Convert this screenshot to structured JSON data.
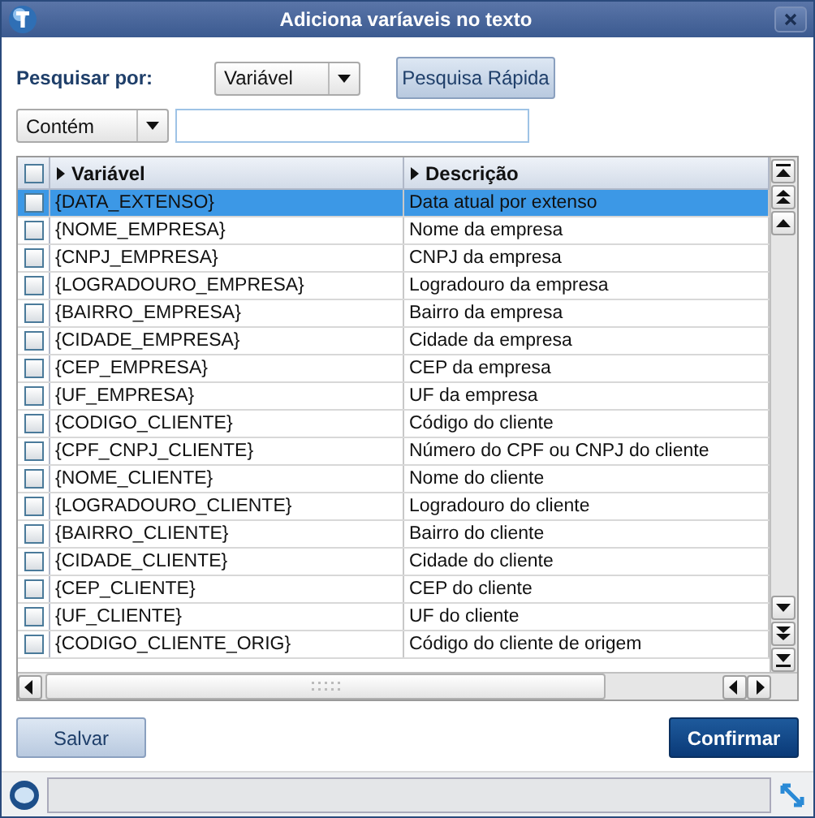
{
  "window": {
    "title": "Adiciona varíaveis no texto"
  },
  "search": {
    "label": "Pesquisar por:",
    "field_select": "Variável",
    "quick_button": "Pesquisa Rápida",
    "operator_select": "Contém"
  },
  "table": {
    "all_checked": false,
    "columns": [
      "Variável",
      "Descrição"
    ],
    "rows": [
      {
        "variable": "{DATA_EXTENSO}",
        "description": "Data atual por extenso",
        "checked": false,
        "selected": true
      },
      {
        "variable": "{NOME_EMPRESA}",
        "description": "Nome da empresa",
        "checked": false,
        "selected": false
      },
      {
        "variable": "{CNPJ_EMPRESA}",
        "description": "CNPJ da empresa",
        "checked": false,
        "selected": false
      },
      {
        "variable": "{LOGRADOURO_EMPRESA}",
        "description": "Logradouro da empresa",
        "checked": false,
        "selected": false
      },
      {
        "variable": "{BAIRRO_EMPRESA}",
        "description": "Bairro da empresa",
        "checked": false,
        "selected": false
      },
      {
        "variable": "{CIDADE_EMPRESA}",
        "description": "Cidade da empresa",
        "checked": false,
        "selected": false
      },
      {
        "variable": "{CEP_EMPRESA}",
        "description": "CEP da empresa",
        "checked": false,
        "selected": false
      },
      {
        "variable": "{UF_EMPRESA}",
        "description": "UF da empresa",
        "checked": false,
        "selected": false
      },
      {
        "variable": "{CODIGO_CLIENTE}",
        "description": "Código do cliente",
        "checked": false,
        "selected": false
      },
      {
        "variable": "{CPF_CNPJ_CLIENTE}",
        "description": "Número do CPF ou CNPJ do cliente",
        "checked": false,
        "selected": false
      },
      {
        "variable": "{NOME_CLIENTE}",
        "description": "Nome do cliente",
        "checked": false,
        "selected": false
      },
      {
        "variable": "{LOGRADOURO_CLIENTE}",
        "description": "Logradouro do cliente",
        "checked": false,
        "selected": false
      },
      {
        "variable": "{BAIRRO_CLIENTE}",
        "description": "Bairro do cliente",
        "checked": false,
        "selected": false
      },
      {
        "variable": "{CIDADE_CLIENTE}",
        "description": "Cidade do cliente",
        "checked": false,
        "selected": false
      },
      {
        "variable": "{CEP_CLIENTE}",
        "description": "CEP do cliente",
        "checked": false,
        "selected": false
      },
      {
        "variable": "{UF_CLIENTE}",
        "description": "UF do cliente",
        "checked": false,
        "selected": false
      },
      {
        "variable": "{CODIGO_CLIENTE_ORIG}",
        "description": "Código do cliente de origem",
        "checked": false,
        "selected": false
      }
    ]
  },
  "buttons": {
    "save": "Salvar",
    "confirm": "Confirmar"
  }
}
